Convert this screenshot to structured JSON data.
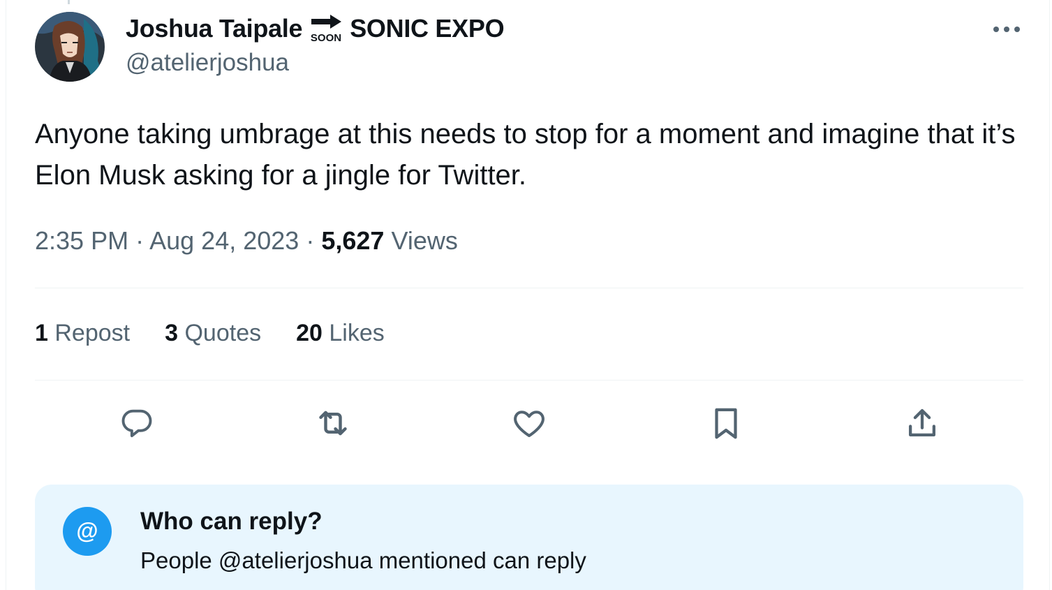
{
  "author": {
    "display_name": "Joshua Taipale",
    "badge_text": "SOON",
    "name_suffix": "SONIC EXPO",
    "handle": "@atelierjoshua",
    "avatar_icon": "avatar-portrait"
  },
  "tweet": {
    "text": "Anyone taking umbrage at this needs to stop for a moment and imagine that it’s Elon Musk asking for a jingle for Twitter.",
    "time": "2:35 PM",
    "separator": "·",
    "date": "Aug 24, 2023",
    "views_count": "5,627",
    "views_label": "Views"
  },
  "stats": {
    "reposts_count": "1",
    "reposts_label": "Repost",
    "quotes_count": "3",
    "quotes_label": "Quotes",
    "likes_count": "20",
    "likes_label": "Likes"
  },
  "actions": {
    "icons": [
      "reply-icon",
      "retweet-icon",
      "like-icon",
      "bookmark-icon",
      "share-icon"
    ]
  },
  "reply_settings": {
    "badge_symbol": "@",
    "title": "Who can reply?",
    "description": "People @atelierjoshua mentioned can reply"
  },
  "colors": {
    "text_primary": "#0f1419",
    "text_secondary": "#536471",
    "accent": "#1d9bf0",
    "reply_box_bg": "#e8f6fe",
    "divider": "#eff3f4"
  }
}
